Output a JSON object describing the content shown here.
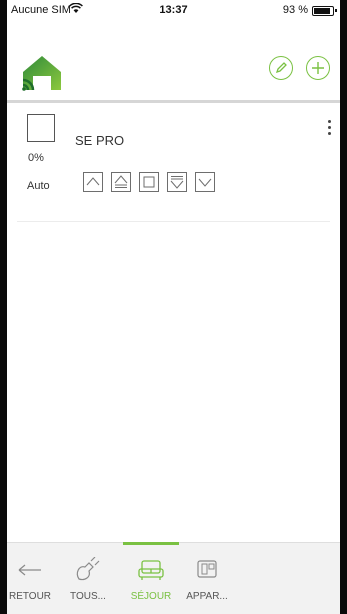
{
  "status_bar": {
    "carrier": "Aucune SIM",
    "time": "13:37",
    "battery": "93 %"
  },
  "header": {
    "logo_icon": "home-wifi-logo-icon",
    "edit_icon": "pencil-icon",
    "add_icon": "plus-icon",
    "accent_color": "#7ac142"
  },
  "device": {
    "name": "SE PRO",
    "position": "0%",
    "mode": "Auto",
    "controls": [
      "up",
      "up-stop",
      "stop",
      "down-stop",
      "down"
    ]
  },
  "tabbar": {
    "retour": "RETOUR",
    "tous": "TOUS...",
    "sejour": "SÉJOUR",
    "appar": "APPAR...",
    "active": "sejour"
  }
}
